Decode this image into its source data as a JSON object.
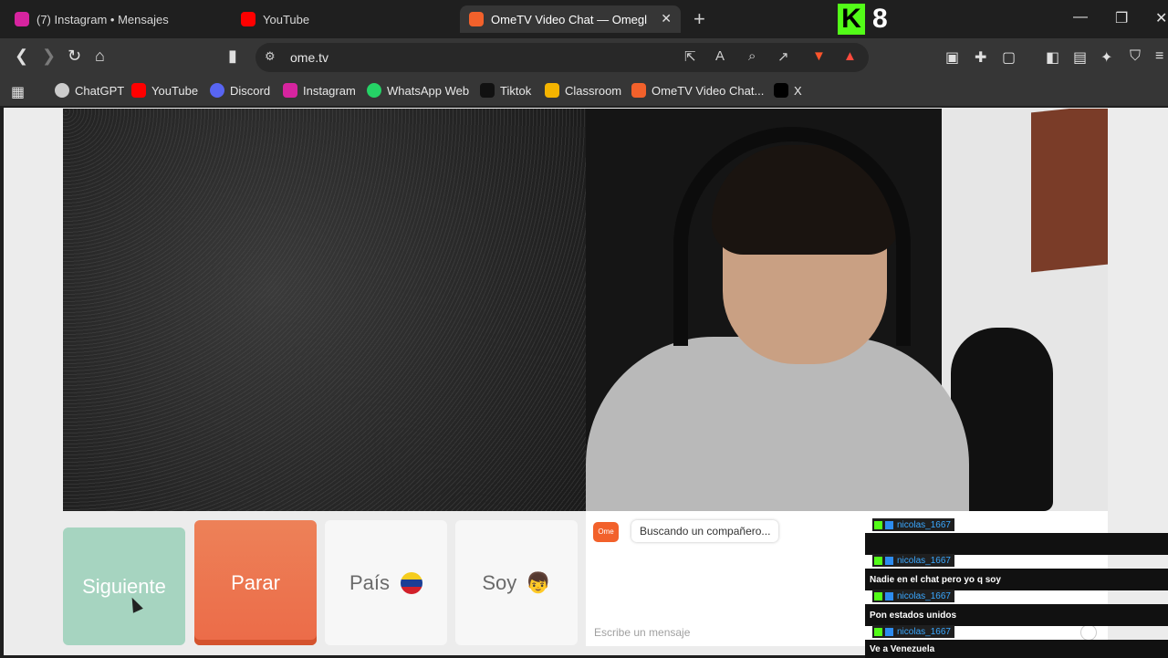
{
  "browser": {
    "tabs": [
      {
        "title": "(7) Instagram • Mensajes",
        "icon": "instagram-icon",
        "color": "#d6249f"
      },
      {
        "title": "YouTube",
        "icon": "youtube-icon",
        "color": "#ff0000"
      },
      {
        "title": "OmeTV Video Chat — Omegl",
        "icon": "ometv-icon",
        "color": "#f2612b"
      }
    ],
    "kick_badge": {
      "letter": "K",
      "number": "8"
    },
    "url": "ome.tv",
    "bookmarks": [
      {
        "label": "ChatGPT",
        "icon": "chatgpt-icon",
        "color": "#cccccc"
      },
      {
        "label": "YouTube",
        "icon": "youtube-icon",
        "color": "#ff0000"
      },
      {
        "label": "Discord",
        "icon": "discord-icon",
        "color": "#5865f2"
      },
      {
        "label": "Instagram",
        "icon": "instagram-icon",
        "color": "#d6249f"
      },
      {
        "label": "WhatsApp Web",
        "icon": "whatsapp-icon",
        "color": "#25d366"
      },
      {
        "label": "Tiktok",
        "icon": "tiktok-icon",
        "color": "#111111"
      },
      {
        "label": "Classroom",
        "icon": "classroom-icon",
        "color": "#f4b400"
      },
      {
        "label": "OmeTV Video Chat...",
        "icon": "ometv-icon",
        "color": "#f2612b"
      },
      {
        "label": "X",
        "icon": "x-icon",
        "color": "#000000"
      }
    ]
  },
  "controls": {
    "next": "Siguiente",
    "stop": "Parar",
    "country": "País",
    "gender": "Soy"
  },
  "chat": {
    "status": "Buscando un compañero...",
    "placeholder": "Escribe un mensaje"
  },
  "stream_chat": [
    {
      "user": "nicolas_1667",
      "text": ""
    },
    {
      "user": "nicolas_1667",
      "text": "Nadie en el chat pero yo q soy"
    },
    {
      "user": "nicolas_1667",
      "text": "Pon estados unidos"
    },
    {
      "user": "nicolas_1667",
      "text": "Ve a Venezuela"
    }
  ]
}
